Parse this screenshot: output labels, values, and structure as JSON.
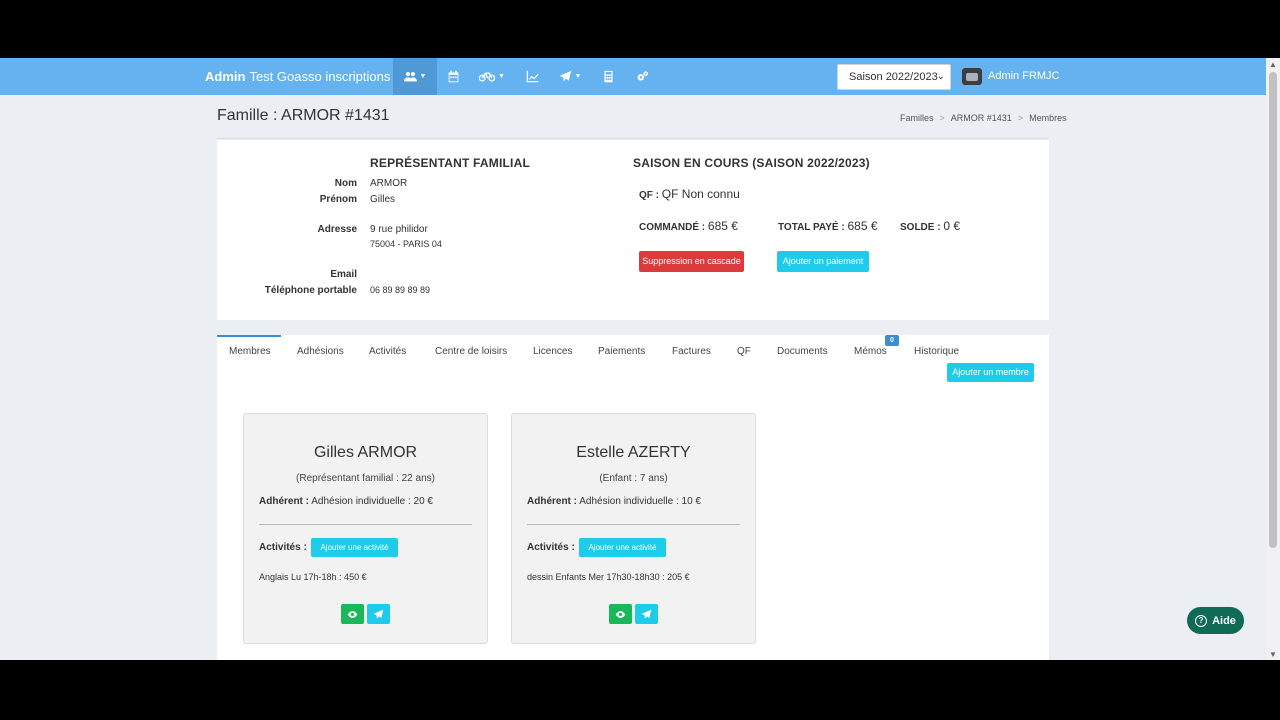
{
  "navbar": {
    "brand_strong": "Admin",
    "brand_rest": "Test Goasso inscriptions",
    "icons": [
      "users-icon",
      "calendar-icon",
      "bicycle-icon",
      "line-chart-icon",
      "paper-plane-icon",
      "calculator-icon",
      "cogs-icon"
    ],
    "season_selected": "Saison 2022/2023",
    "user_name": "Admin FRMJC"
  },
  "page": {
    "title": "Famille : ARMOR #1431",
    "breadcrumb": [
      "Familles",
      "ARMOR #1431",
      "Membres"
    ]
  },
  "representative": {
    "heading": "REPRÉSENTANT FAMILIAL",
    "nom_label": "Nom",
    "nom": "ARMOR",
    "prenom_label": "Prénom",
    "prenom": "Gilles",
    "adresse_label": "Adresse",
    "adresse_line1": "9 rue philidor",
    "adresse_line2": "75004 - PARIS 04",
    "email_label": "Email",
    "email": "",
    "tel_label": "Téléphone portable",
    "tel": "06 89 89 89 89"
  },
  "season": {
    "heading": "SAISON EN COURS (SAISON 2022/2023)",
    "qf_label": "QF :",
    "qf_value": "QF Non connu",
    "commande_label": "COMMANDÉ :",
    "commande_value": "685 €",
    "total_paye_label": "TOTAL PAYÉ :",
    "total_paye_value": "685 €",
    "solde_label": "SOLDE :",
    "solde_value": "0 €",
    "delete_button": "Suppression en cascade",
    "add_payment_button": "Ajouter un paiement"
  },
  "tabs": [
    "Membres",
    "Adhésions",
    "Activités",
    "Centre de loisirs",
    "Licences",
    "Paiements",
    "Factures",
    "QF",
    "Documents",
    "Mémos",
    "Historique"
  ],
  "memo_badge": "0",
  "add_member_button": "Ajouter un membre",
  "members": [
    {
      "name": "Gilles ARMOR",
      "role": "(Représentant familial : 22 ans)",
      "adh_label": "Adhérent :",
      "adh_value": "Adhésion individuelle : 20 €",
      "activities_label": "Activités :",
      "add_activity": "Ajouter une activité",
      "activity": "Anglais Lu 17h-18h : 450 €"
    },
    {
      "name": "Estelle AZERTY",
      "role": "(Enfant : 7 ans)",
      "adh_label": "Adhérent :",
      "adh_value": "Adhésion individuelle : 10 €",
      "activities_label": "Activités :",
      "add_activity": "Ajouter une activité",
      "activity": "dessin Enfants Mer 17h30-18h30 : 205 €"
    }
  ],
  "help_button": "Aide"
}
